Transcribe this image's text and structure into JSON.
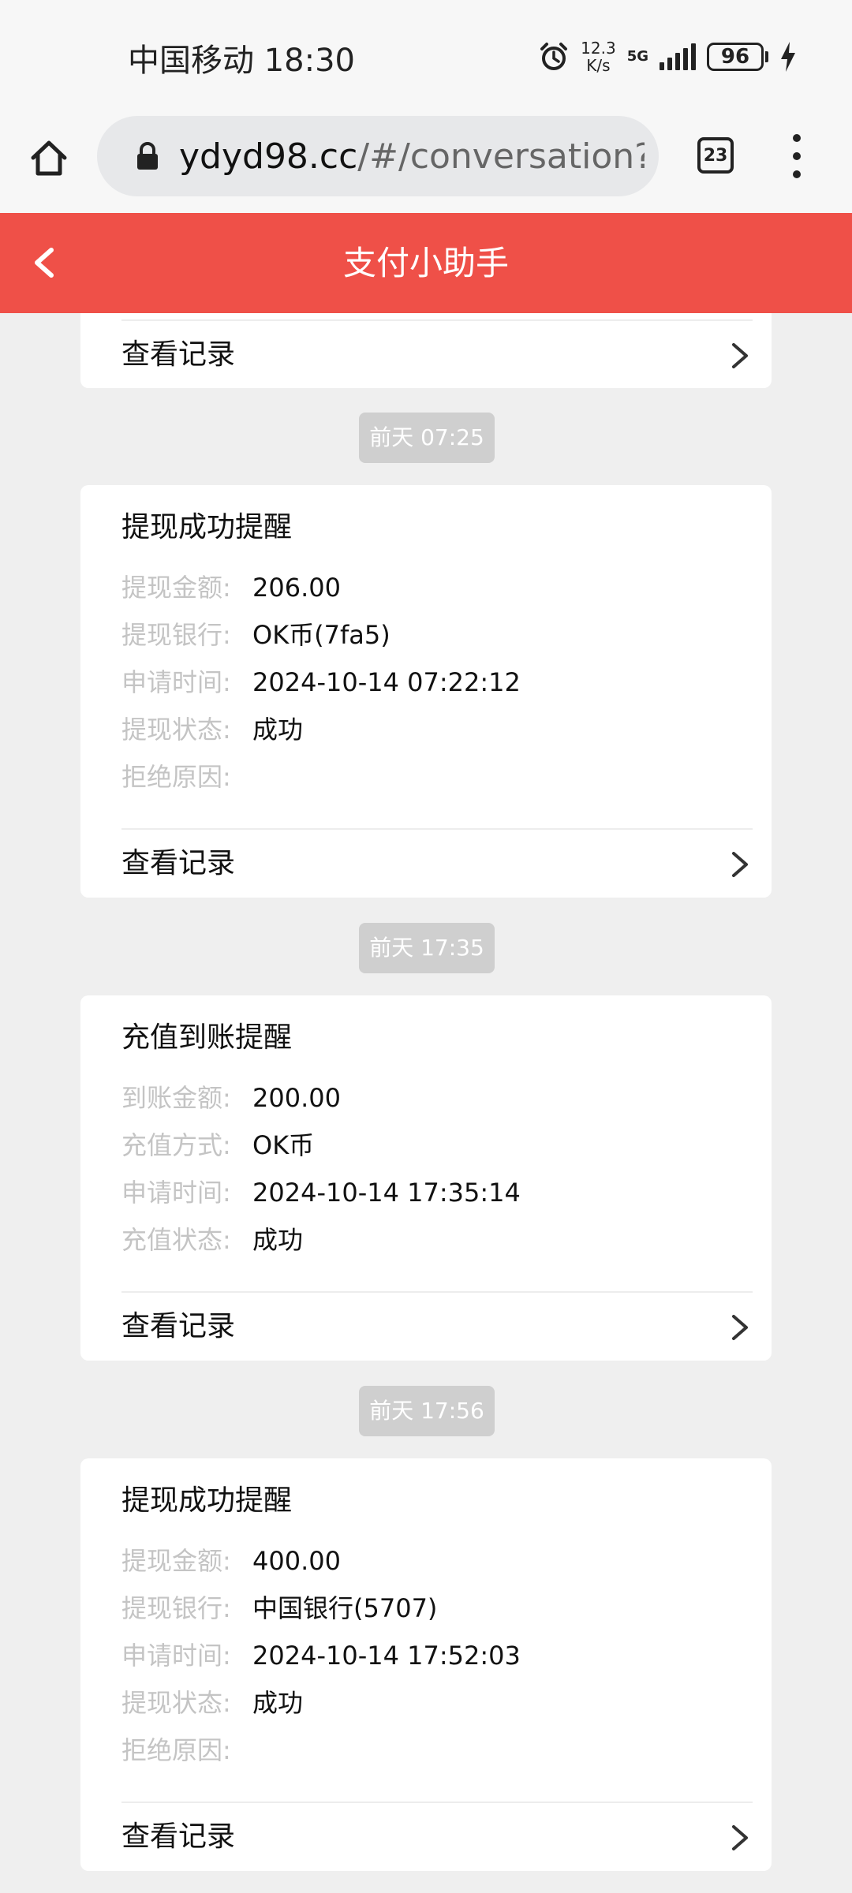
{
  "status_bar": {
    "carrier_time": "中国移动 18:30",
    "speed_value": "12.3",
    "speed_unit": "K/s",
    "network": "5G",
    "battery": "96",
    "icons": [
      "alarm-icon",
      "signal-icon",
      "battery-icon",
      "charging-icon"
    ]
  },
  "browser": {
    "url_domain": "ydyd98.cc",
    "url_path": "/#/conversation?u",
    "tab_count": "23",
    "icons": [
      "home-icon",
      "lock-icon",
      "more-icon"
    ]
  },
  "header": {
    "title": "支付小助手",
    "accent_color": "#ef5048"
  },
  "top_card": {
    "link_label": "查看记录"
  },
  "messages": [
    {
      "time": "前天 07:25",
      "title": "提现成功提醒",
      "rows": [
        {
          "label": "提现金额:",
          "value": "206.00"
        },
        {
          "label": "提现银行:",
          "value": "OK币(7fa5)"
        },
        {
          "label": "申请时间:",
          "value": "2024-10-14 07:22:12"
        },
        {
          "label": "提现状态:",
          "value": "成功"
        },
        {
          "label": "拒绝原因:",
          "value": ""
        }
      ],
      "link_label": "查看记录"
    },
    {
      "time": "前天 17:35",
      "title": "充值到账提醒",
      "rows": [
        {
          "label": "到账金额:",
          "value": "200.00"
        },
        {
          "label": "充值方式:",
          "value": "OK币"
        },
        {
          "label": "申请时间:",
          "value": "2024-10-14 17:35:14"
        },
        {
          "label": "充值状态:",
          "value": "成功"
        }
      ],
      "link_label": "查看记录"
    },
    {
      "time": "前天 17:56",
      "title": "提现成功提醒",
      "rows": [
        {
          "label": "提现金额:",
          "value": "400.00"
        },
        {
          "label": "提现银行:",
          "value": "中国银行(5707)"
        },
        {
          "label": "申请时间:",
          "value": "2024-10-14 17:52:03"
        },
        {
          "label": "提现状态:",
          "value": "成功"
        },
        {
          "label": "拒绝原因:",
          "value": ""
        }
      ],
      "link_label": "查看记录"
    }
  ]
}
